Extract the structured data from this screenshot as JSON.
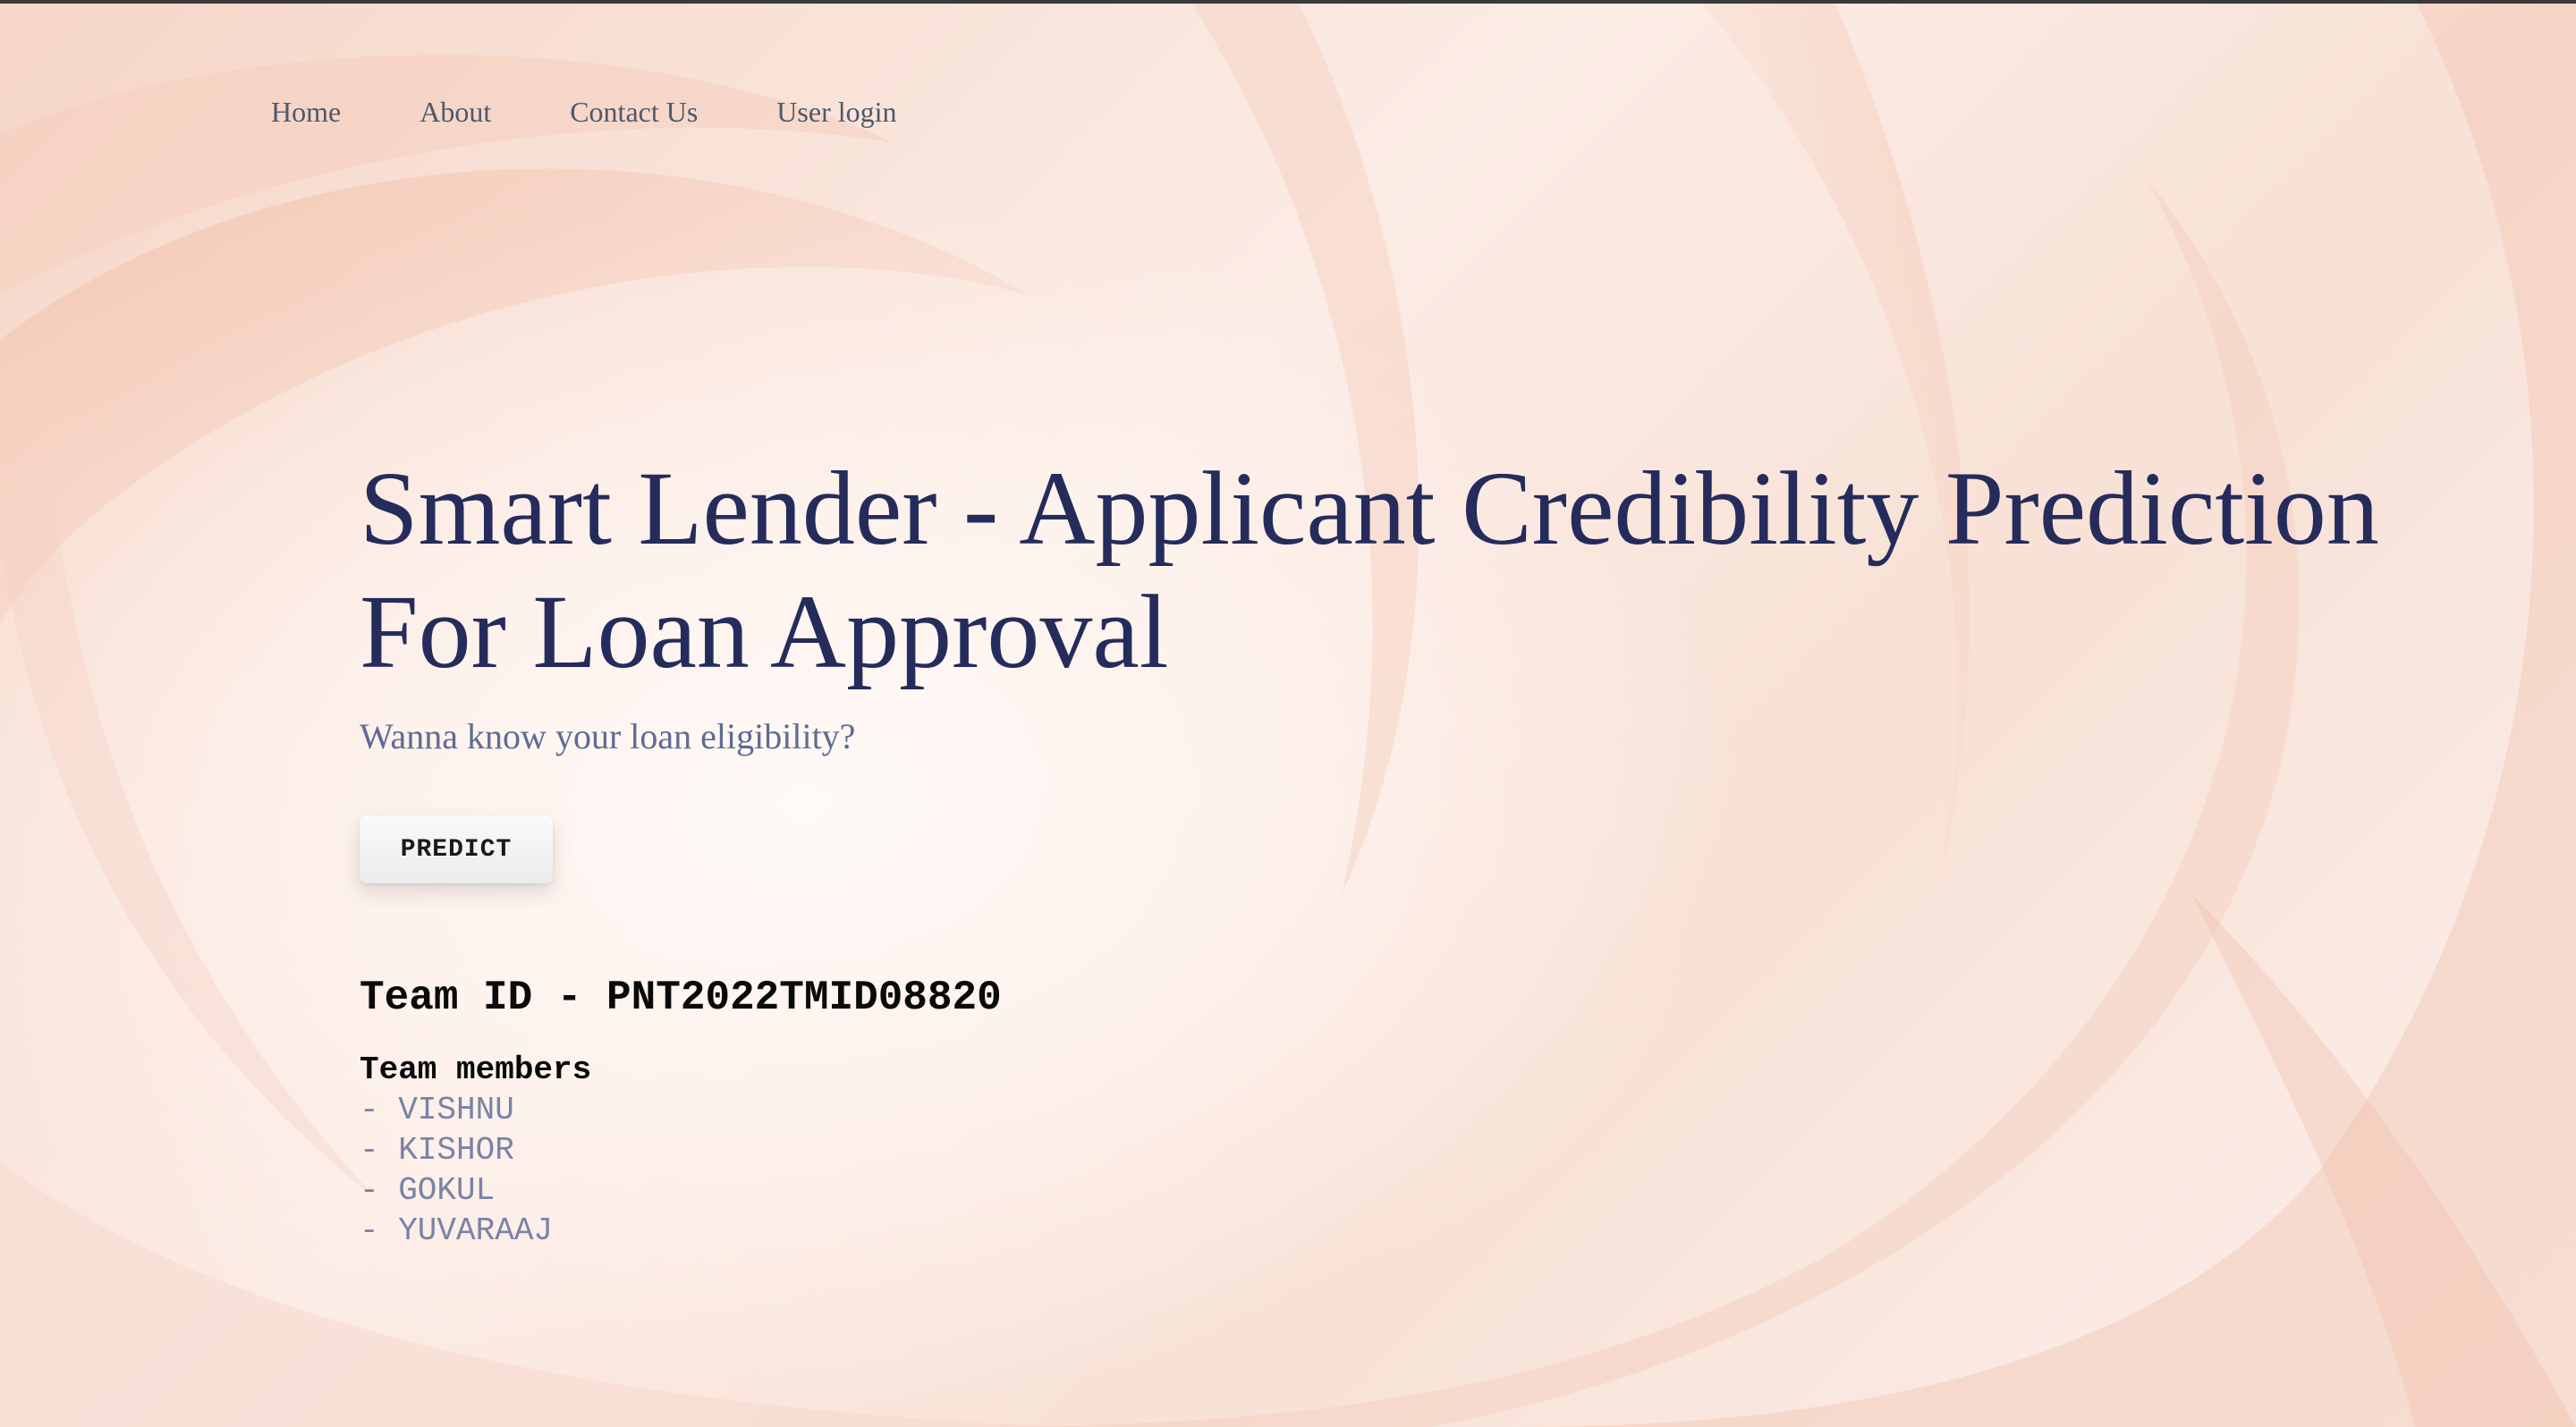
{
  "nav": {
    "items": [
      {
        "label": "Home"
      },
      {
        "label": "About"
      },
      {
        "label": "Contact Us"
      },
      {
        "label": "User login"
      }
    ]
  },
  "hero": {
    "title": "Smart Lender - Applicant Credibility Prediction For Loan Approval",
    "subtitle": "Wanna know your loan eligibility?",
    "predict_label": "PREDICT"
  },
  "team": {
    "id_text": "Team ID - PNT2022TMID08820",
    "members_title": "Team members",
    "members": [
      "- VISHNU",
      "- KISHOR",
      "- GOKUL",
      "- YUVARAAJ"
    ]
  },
  "colors": {
    "title": "#252c5c",
    "subtitle": "#5f6b93",
    "nav": "#4c5a6b",
    "member": "#7a83a6",
    "background": "#fbeee8"
  }
}
